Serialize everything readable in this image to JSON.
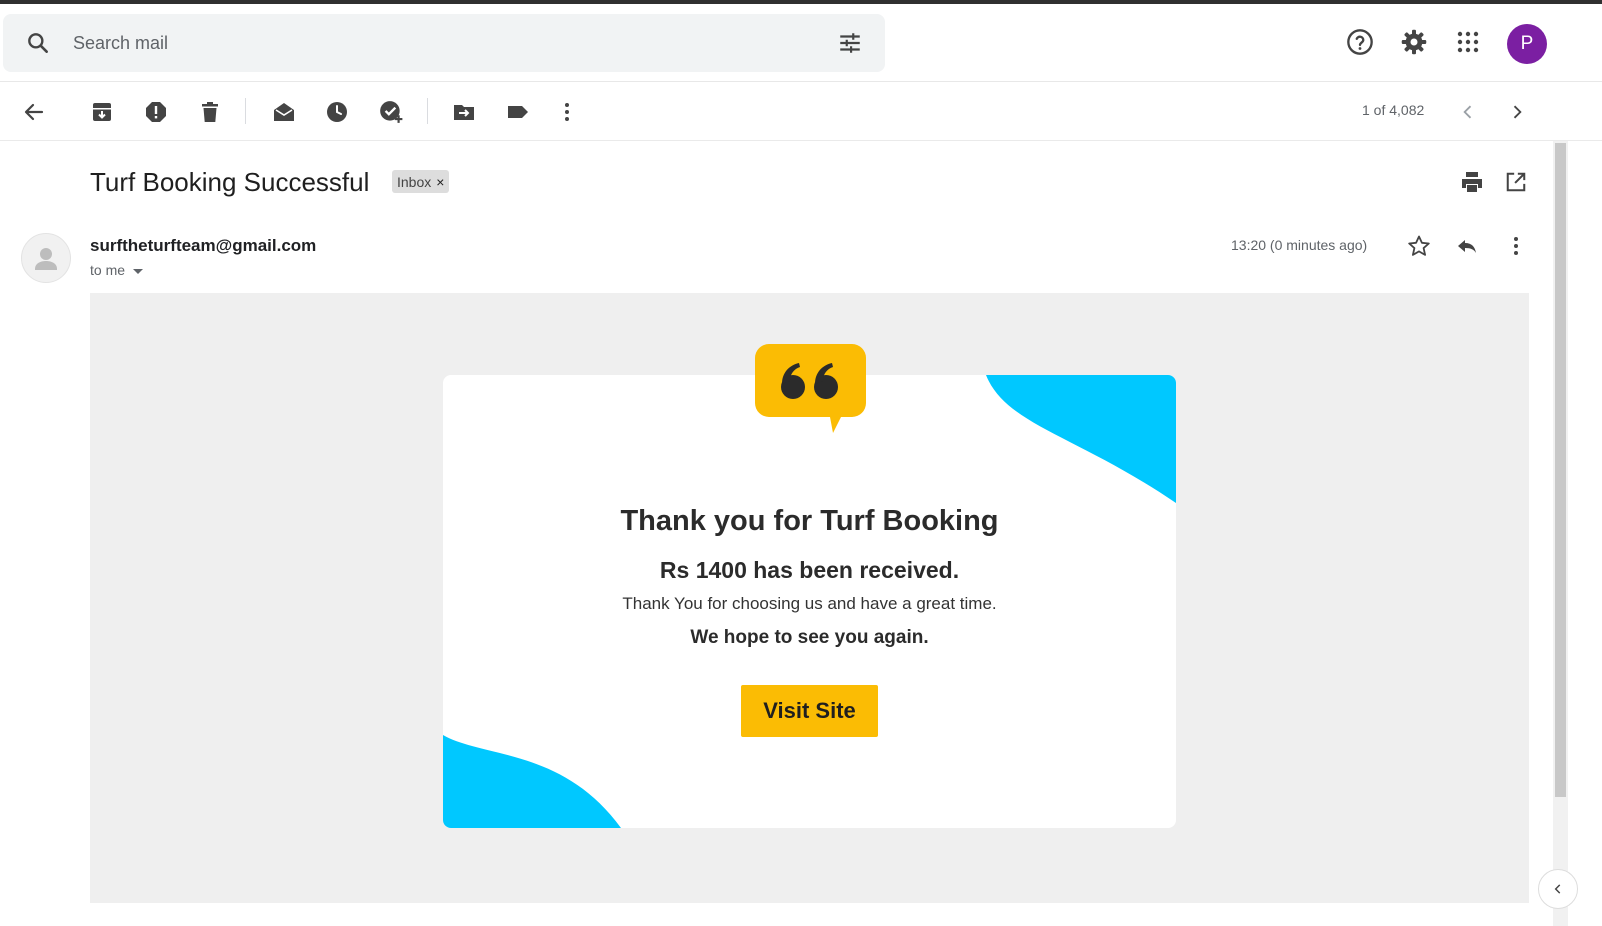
{
  "search": {
    "placeholder": "Search mail"
  },
  "header": {
    "avatar_letter": "P",
    "avatar_color": "#7b1fa2"
  },
  "toolbar": {
    "pager": "1 of 4,082"
  },
  "message": {
    "subject": "Turf Booking Successful",
    "label": "Inbox",
    "label_remove": "×",
    "sender": "surftheturfteam@gmail.com",
    "recipient": "to me",
    "time": "13:20 (0 minutes ago)"
  },
  "email_body": {
    "heading": "Thank you for Turf Booking",
    "amount_line": "Rs 1400 has been received.",
    "choose_line": "Thank You for choosing us and have a great time.",
    "hope_line": "We hope to see you again.",
    "button_label": "Visit Site",
    "accent_yellow": "#fbbc04",
    "accent_cyan": "#00c8ff"
  }
}
